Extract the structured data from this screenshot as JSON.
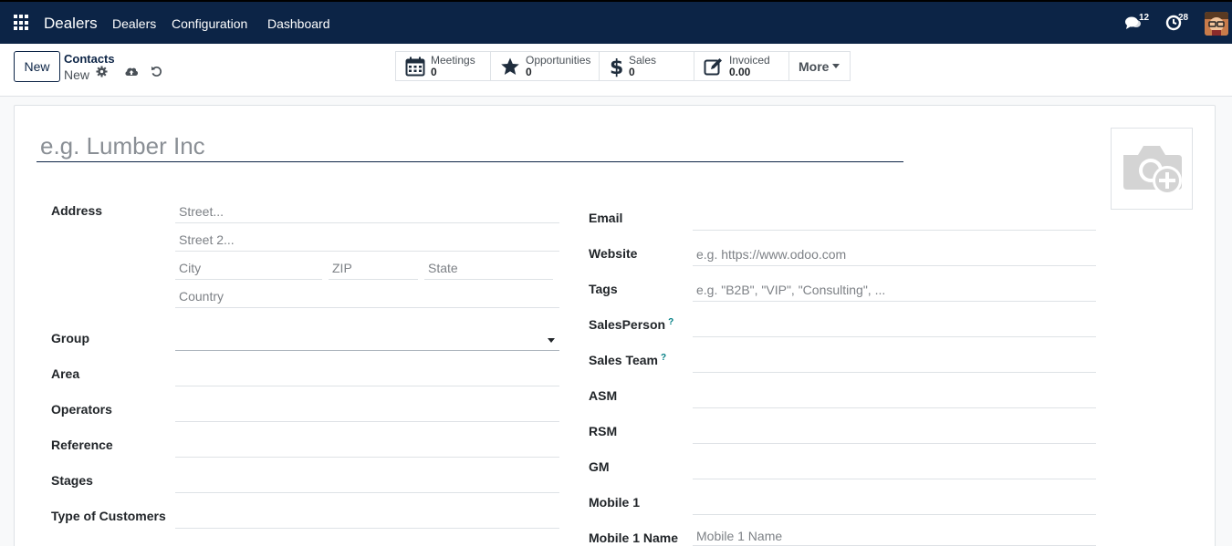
{
  "navbar": {
    "brand": "Dealers",
    "menu": [
      "Dealers",
      "Configuration",
      "Dashboard"
    ],
    "messages_count": "12",
    "activities_count": "28"
  },
  "control": {
    "new_label": "New",
    "breadcrumb_parent": "Contacts",
    "breadcrumb_current": "New",
    "stats": [
      {
        "label": "Meetings",
        "value": "0"
      },
      {
        "label": "Opportunities",
        "value": "0"
      },
      {
        "label": "Sales",
        "value": "0"
      },
      {
        "label": "Invoiced",
        "value": "0.00"
      }
    ],
    "more_label": "More"
  },
  "form": {
    "name_placeholder": "e.g. Lumber Inc",
    "left": {
      "address_label": "Address",
      "street_placeholder": "Street...",
      "street2_placeholder": "Street 2...",
      "city_placeholder": "City",
      "zip_placeholder": "ZIP",
      "state_placeholder": "State",
      "country_placeholder": "Country",
      "group_label": "Group",
      "area_label": "Area",
      "operators_label": "Operators",
      "reference_label": "Reference",
      "stages_label": "Stages",
      "customer_type_label": "Type of Customers"
    },
    "right": {
      "email_label": "Email",
      "website_label": "Website",
      "website_placeholder": "e.g. https://www.odoo.com",
      "tags_label": "Tags",
      "tags_placeholder": "e.g. \"B2B\", \"VIP\", \"Consulting\", ...",
      "salesperson_label": "SalesPerson",
      "sales_team_label": "Sales Team",
      "help_mark": "?",
      "asm_label": "ASM",
      "rsm_label": "RSM",
      "gm_label": "GM",
      "mobile1_label": "Mobile 1",
      "mobile1_name_label": "Mobile 1 Name",
      "mobile1_name_placeholder": "Mobile 1 Name"
    }
  },
  "colors": {
    "navbar": "#0c2446",
    "accent": "#017e84"
  }
}
